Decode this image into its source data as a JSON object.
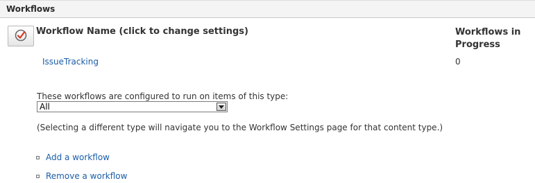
{
  "section": {
    "title": "Workflows"
  },
  "table": {
    "icon": "workflow-check-icon",
    "col_name_header": "Workflow Name (click to change settings)",
    "col_progress_header": "Workflows in Progress",
    "rows": [
      {
        "name": "IssueTracking",
        "in_progress": "0"
      }
    ]
  },
  "content_type": {
    "label": "These workflows are configured to run on items of this type:",
    "selected": "All",
    "note": "(Selecting a different type will navigate you to the Workflow Settings page for that content type.)"
  },
  "actions": {
    "add_label": "Add a workflow",
    "remove_label": "Remove a workflow"
  },
  "colors": {
    "link": "#1b5da8",
    "icon_accent": "#d9341f"
  }
}
